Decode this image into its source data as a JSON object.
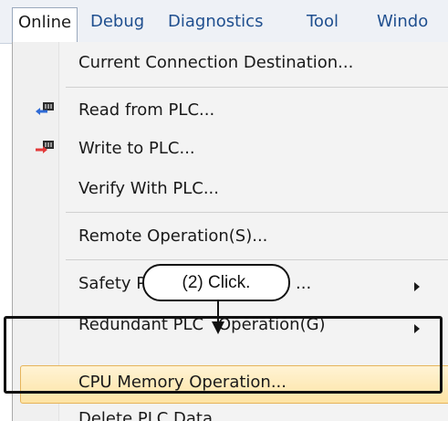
{
  "menubar": {
    "items": [
      {
        "label": "Online"
      },
      {
        "label": "Debug"
      },
      {
        "label": "Diagnostics"
      },
      {
        "label": "Tool"
      },
      {
        "label": "Windo"
      }
    ]
  },
  "menu": {
    "current_connection": "Current Connection Destination...",
    "read_from_plc": "Read from PLC...",
    "write_to_plc": "Write to PLC...",
    "verify_with_plc": "Verify With PLC...",
    "remote_operation": "Remote Operation(S)...",
    "safety_prefix": "Safety P",
    "safety_suffix": "...",
    "redundant_prefix": "Redundant PLC",
    "redundant_suffix": "Operation(G)",
    "cpu_memory": "CPU Memory Operation...",
    "delete_plc_data": "Delete PLC Data..."
  },
  "callout": {
    "text": "(2) Click."
  },
  "colors": {
    "accent_blue": "#1f4f8f",
    "highlight_fill": "#fde3a4",
    "highlight_border": "#e6b45a",
    "read_icon_arrow": "#2f6bd6",
    "write_icon_arrow": "#e23b3b"
  },
  "icons": [
    "read-from-plc-icon",
    "write-to-plc-icon",
    "submenu-arrow-icon"
  ]
}
